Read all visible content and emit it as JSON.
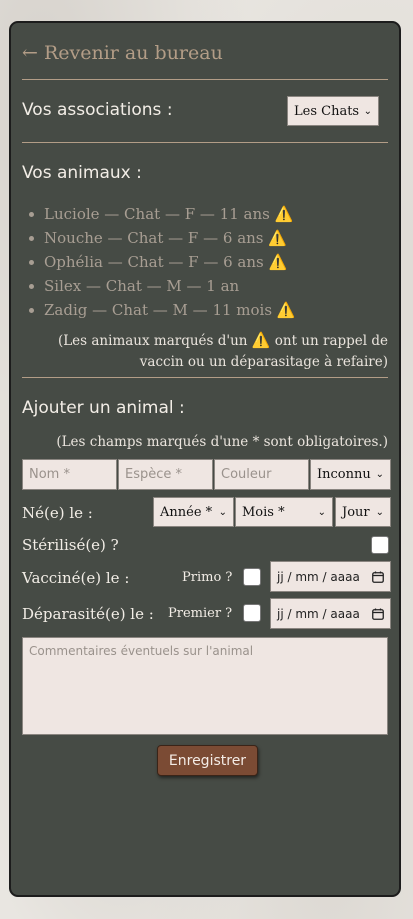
{
  "nav": {
    "back_label": "← Revenir au bureau"
  },
  "associations": {
    "heading": "Vos associations :",
    "selected": "Les Chats"
  },
  "animals": {
    "heading": "Vos animaux :",
    "items": [
      {
        "text": "Luciole — Chat — F — 11 ans",
        "warning": "⚠️"
      },
      {
        "text": "Nouche — Chat — F — 6 ans",
        "warning": "⚠️"
      },
      {
        "text": "Ophélia — Chat — F — 6 ans",
        "warning": "⚠️"
      },
      {
        "text": "Silex — Chat — M — 1 an",
        "warning": ""
      },
      {
        "text": "Zadig — Chat — M — 11 mois",
        "warning": "⚠️"
      }
    ],
    "note_line1_pre": "(Les animaux marqués d'un",
    "note_icon": "⚠️",
    "note_line1_post": "ont un rappel de",
    "note_line2": "vaccin ou un déparasitage à refaire)"
  },
  "add_form": {
    "heading": "Ajouter un animal :",
    "required_note": "(Les champs marqués d'une * sont obligatoires.)",
    "name_placeholder": "Nom *",
    "species_placeholder": "Espèce *",
    "color_placeholder": "Couleur",
    "sex_selected": "Inconnu",
    "born_label": "Né(e) le :",
    "year_selected": "Année *",
    "month_selected": "Mois *",
    "day_selected": "Jour",
    "sterilized_label": "Stérilisé(e) ?",
    "vaccinated_label": "Vacciné(e) le :",
    "primo_label": "Primo ?",
    "vaccine_date_placeholder": "jj / mm / aaaa",
    "dewormed_label": "Déparasité(e) le :",
    "premier_label": "Premier ?",
    "deworm_date_placeholder": "jj / mm / aaaa",
    "comments_placeholder": "Commentaires éventuels sur l'animal",
    "save_label": "Enregistrer"
  },
  "colors": {
    "panel_bg": "#464b45",
    "accent": "#b39d87",
    "button": "#7b4b34",
    "warning": "#f1c20f"
  }
}
